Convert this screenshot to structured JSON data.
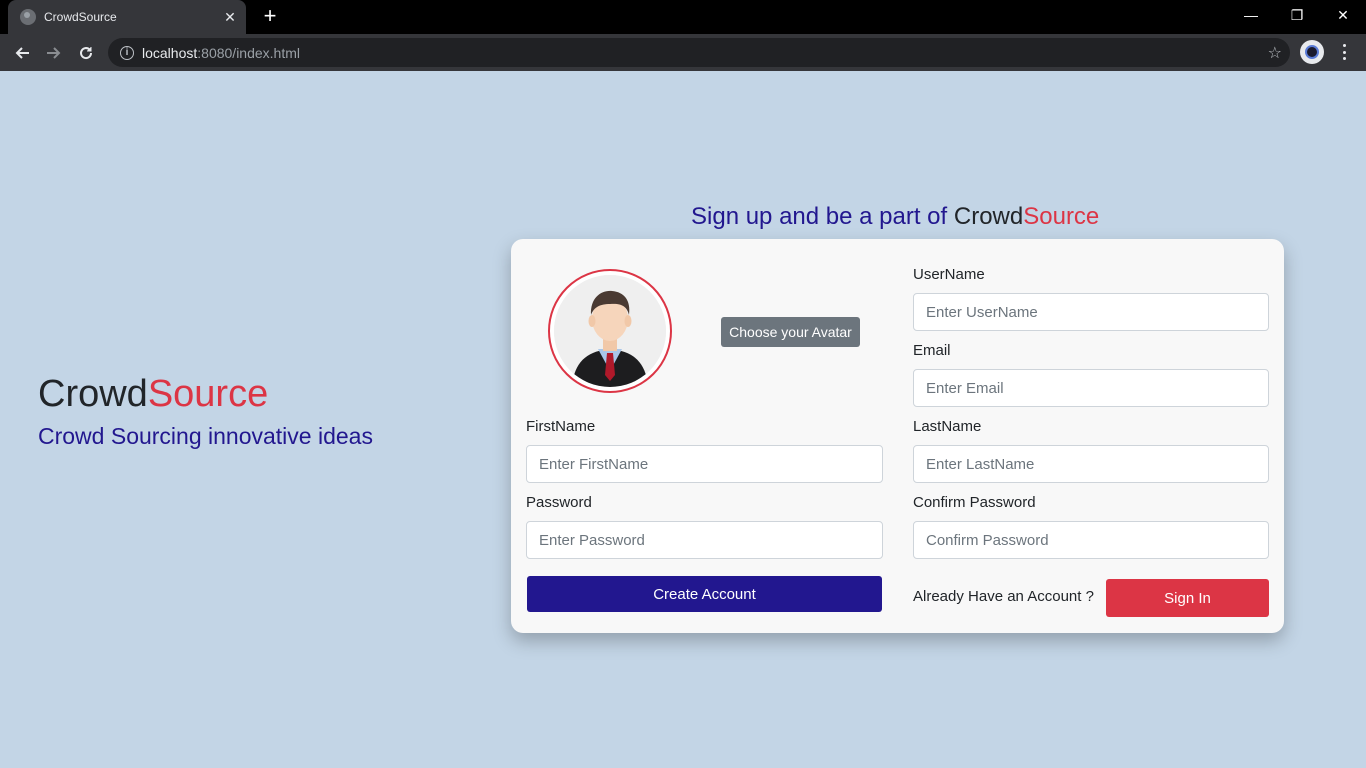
{
  "browser": {
    "tab_title": "CrowdSource",
    "tab_close": "✕",
    "new_tab": "+",
    "url_host": "localhost",
    "url_path": ":8080/index.html",
    "minimize": "—",
    "restore": "❐",
    "close": "✕",
    "star": "☆"
  },
  "brand": {
    "part1": "Crowd",
    "part2": "Source",
    "tagline": "Crowd Sourcing innovative ideas"
  },
  "heading": {
    "prefix": "Sign up and be a part of ",
    "part1": "Crowd",
    "part2": "Source"
  },
  "form": {
    "choose_avatar": "Choose your Avatar",
    "username_label": "UserName",
    "username_placeholder": "Enter UserName",
    "email_label": "Email",
    "email_placeholder": "Enter Email",
    "firstname_label": "FirstName",
    "firstname_placeholder": "Enter FirstName",
    "lastname_label": "LastName",
    "lastname_placeholder": "Enter LastName",
    "password_label": "Password",
    "password_placeholder": "Enter Password",
    "confirm_label": "Confirm Password",
    "confirm_placeholder": "Confirm Password",
    "create_button": "Create Account",
    "already_text": "Already Have an Account ?",
    "signin_button": "Sign In"
  },
  "colors": {
    "page_bg": "#c3d5e6",
    "brand_red": "#dc3545",
    "brand_navy": "#22178f",
    "secondary_gray": "#6c757d"
  }
}
